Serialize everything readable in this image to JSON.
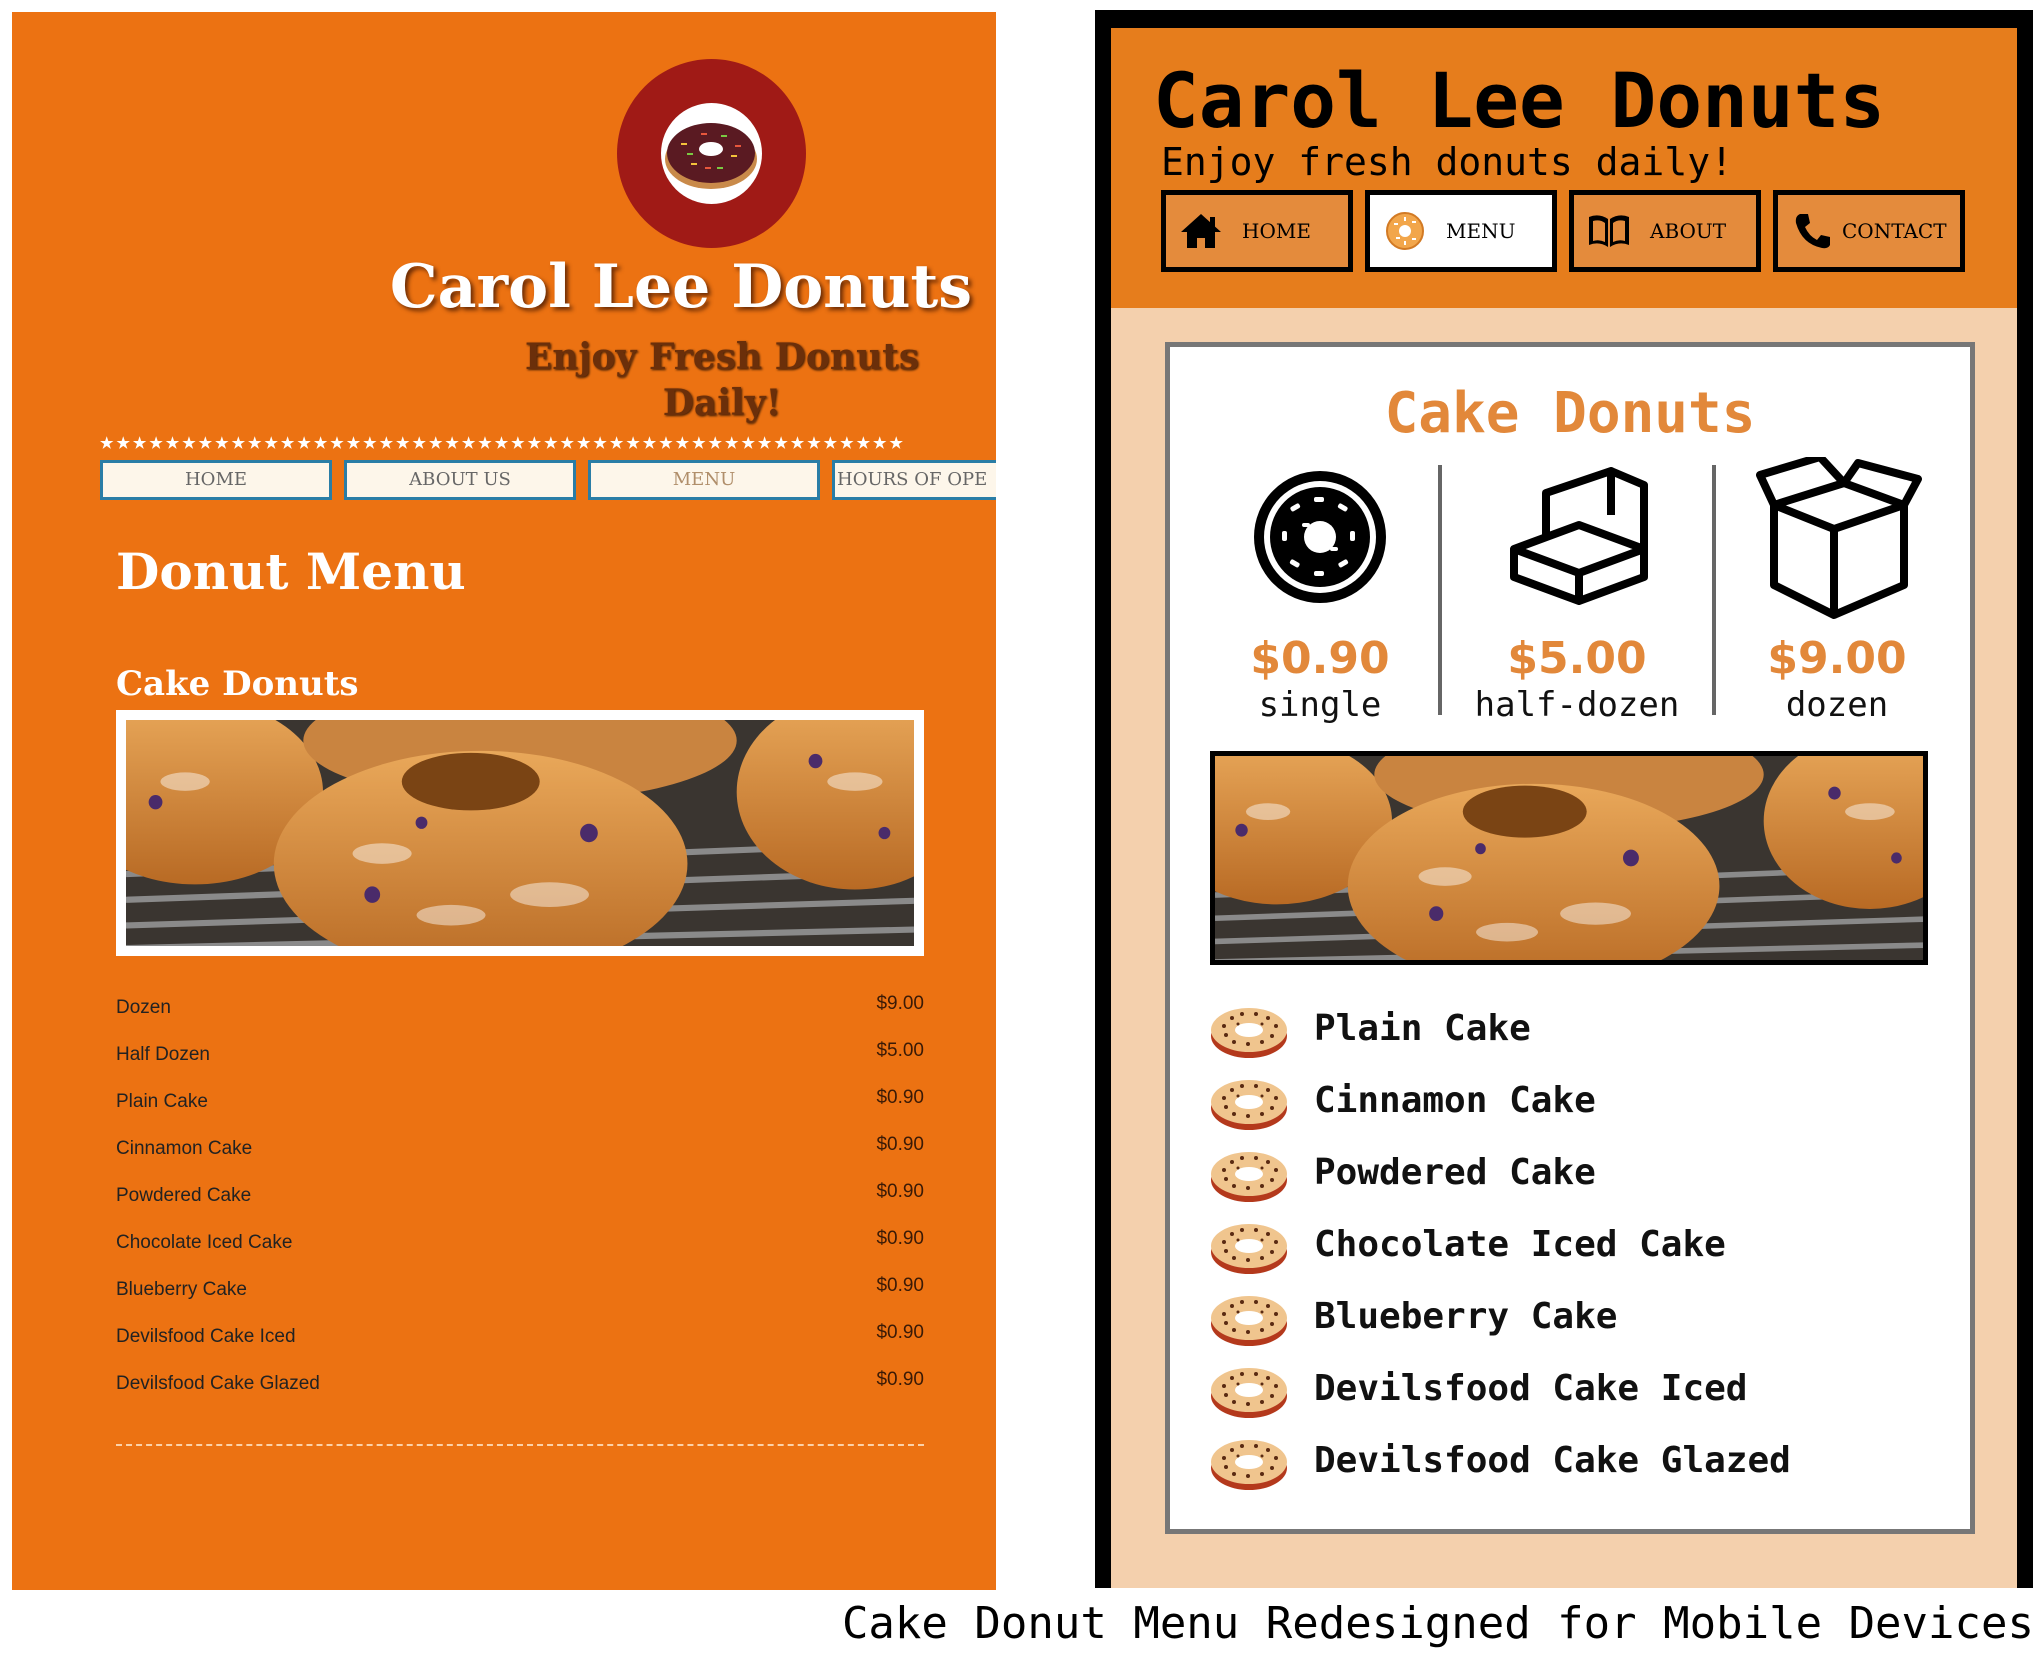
{
  "left": {
    "brand": "Carol Lee Donuts",
    "tagline": "Enjoy Fresh Donuts Daily!",
    "stars": "★★★★★★★★★★★★★★★★★★★★★★★★★★★★★★★★★★★★★★★★★★★★★★★★★",
    "nav": [
      {
        "label": "HOME"
      },
      {
        "label": "ABOUT US"
      },
      {
        "label": "MENU",
        "active": true
      },
      {
        "label": "HOURS OF OPE"
      }
    ],
    "heading": "Donut Menu",
    "section": "Cake Donuts",
    "items": [
      {
        "name": "Dozen",
        "price": "$9.00"
      },
      {
        "name": "Half Dozen",
        "price": "$5.00"
      },
      {
        "name": "Plain Cake",
        "price": "$0.90"
      },
      {
        "name": "Cinnamon Cake",
        "price": "$0.90"
      },
      {
        "name": "Powdered Cake",
        "price": "$0.90"
      },
      {
        "name": "Chocolate Iced Cake",
        "price": "$0.90"
      },
      {
        "name": "Blueberry Cake",
        "price": "$0.90"
      },
      {
        "name": "Devilsfood Cake Iced",
        "price": "$0.90"
      },
      {
        "name": "Devilsfood Cake Glazed",
        "price": "$0.90"
      }
    ]
  },
  "right": {
    "brand": "Carol Lee Donuts",
    "tagline": "Enjoy fresh donuts daily!",
    "nav": [
      {
        "label": "HOME",
        "icon": "home-icon"
      },
      {
        "label": "MENU",
        "icon": "donut-icon",
        "active": true
      },
      {
        "label": "ABOUT",
        "icon": "book-icon"
      },
      {
        "label": "CONTACT",
        "icon": "phone-icon"
      }
    ],
    "section": "Cake Donuts",
    "prices": [
      {
        "price": "$0.90",
        "unit": "single",
        "icon": "donut-icon"
      },
      {
        "price": "$5.00",
        "unit": "half-dozen",
        "icon": "open-box-icon"
      },
      {
        "price": "$9.00",
        "unit": "dozen",
        "icon": "open-carton-icon"
      }
    ],
    "items": [
      "Plain Cake",
      "Cinnamon Cake",
      "Powdered Cake",
      "Chocolate Iced Cake",
      "Blueberry Cake",
      "Devilsfood Cake Iced",
      "Devilsfood Cake Glazed"
    ]
  },
  "caption": "Cake Donut Menu Redesigned for Mobile Devices",
  "colors": {
    "left_bg": "#ec7212",
    "logo_ring": "#a01a16",
    "right_header": "#e67d1c",
    "right_body": "#f4d0ad",
    "accent": "#e2883a"
  }
}
